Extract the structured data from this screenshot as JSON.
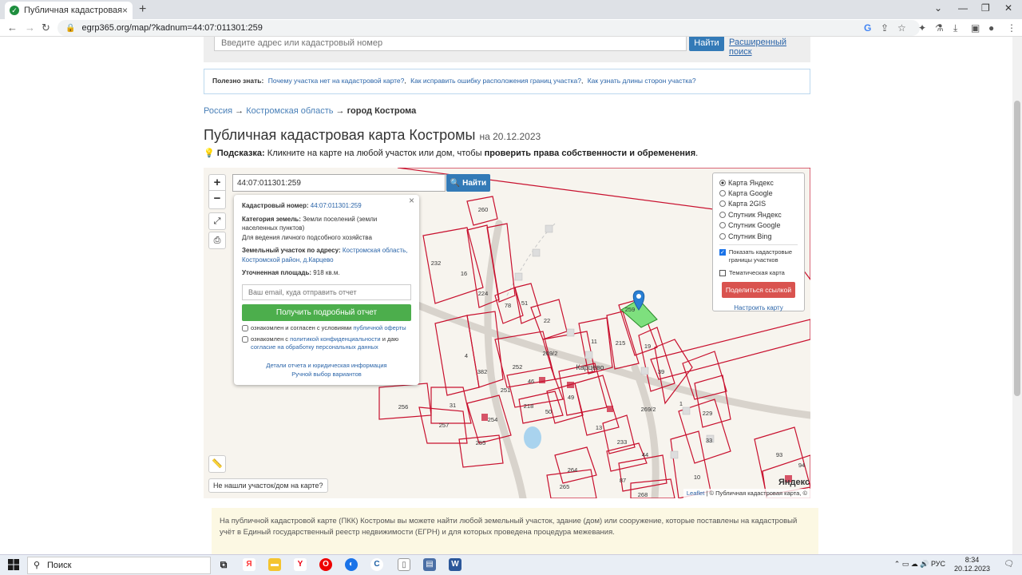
{
  "browser": {
    "tab_title": "Публичная кадастровая карта Ко",
    "tab_close": "×",
    "new_tab": "+",
    "url": "egrp365.org/map/?kadnum=44:07:011301:259"
  },
  "search": {
    "placeholder": "Введите адрес или кадастровый номер",
    "button": "Найти",
    "advanced": "Расширенный поиск"
  },
  "tips": {
    "label": "Полезно знать:",
    "links": [
      "Почему участка нет на кадастровой карте?",
      "Как исправить ошибку расположения границ участка?",
      "Как узнать длины сторон участка?"
    ]
  },
  "breadcrumb": {
    "items": [
      "Россия",
      "Костромская область"
    ],
    "separator": "→",
    "current": "город Кострома"
  },
  "heading": {
    "title": "Публичная кадастровая карта Костромы",
    "date": "на 20.12.2023"
  },
  "hint": {
    "label": "Подсказка:",
    "text": "Кликните на карте на любой участок или дом, чтобы",
    "bold": "проверить права собственности и обременения",
    "end": "."
  },
  "map": {
    "search_value": "44:07:011301:259",
    "search_button": "Найти",
    "zoom_in": "+",
    "zoom_out": "−",
    "village_label": "Карцево",
    "not_found": "Не нашли участок/дом на карте?",
    "attribution_leaflet": "Leaflet",
    "attribution_rest": "| © Публичная кадастровая карта, ©",
    "yandex_logo": "Яндекс",
    "layers": {
      "options": [
        "Карта Яндекс",
        "Карта Google",
        "Карта 2GIS",
        "Спутник Яндекс",
        "Спутник Google",
        "Спутник Bing"
      ],
      "selected": "Карта Яндекс",
      "show_borders": "Показать кадастровые границы участков",
      "thematic": "Тематическая карта",
      "share": "Поделиться ссылкой",
      "setup": "Настроить карту"
    },
    "parcel_labels": [
      {
        "t": "260"
      },
      {
        "t": "232"
      },
      {
        "t": "16"
      },
      {
        "t": "224"
      },
      {
        "t": "78"
      },
      {
        "t": "51"
      },
      {
        "t": "22"
      },
      {
        "t": "11"
      },
      {
        "t": "215"
      },
      {
        "t": "19"
      },
      {
        "t": "39"
      },
      {
        "t": "4"
      },
      {
        "t": "382"
      },
      {
        "t": "252"
      },
      {
        "t": "46"
      },
      {
        "t": "251"
      },
      {
        "t": "49"
      },
      {
        "t": "218"
      },
      {
        "t": "50"
      },
      {
        "t": "13"
      },
      {
        "t": "256"
      },
      {
        "t": "31"
      },
      {
        "t": "257"
      },
      {
        "t": "254"
      },
      {
        "t": "255"
      },
      {
        "t": "233"
      },
      {
        "t": "44"
      },
      {
        "t": "87"
      },
      {
        "t": "264"
      },
      {
        "t": "265"
      },
      {
        "t": "268"
      },
      {
        "t": "229"
      },
      {
        "t": "33"
      },
      {
        "t": "10"
      },
      {
        "t": "93"
      },
      {
        "t": "94"
      },
      {
        "t": "269/2"
      },
      {
        "t": "269/2"
      },
      {
        "t": "259"
      },
      {
        "t": "1"
      }
    ]
  },
  "popup": {
    "close": "×",
    "cadnum_label": "Кадастровый номер:",
    "cadnum": "44:07:011301:259",
    "category_label": "Категория земель:",
    "category": "Земли поселений (земли населенных пунктов)",
    "use": "Для ведения личного подсобного хозяйства",
    "address_label": "Земельный участок по адресу:",
    "address": "Костромская область, Костромской район, д.Карцево",
    "area_label": "Уточненная площадь:",
    "area": "918",
    "area_unit": "кв.м.",
    "email_placeholder": "Ваш email, куда отправить отчет",
    "report_button": "Получить подробный отчет",
    "agree1_text": "ознакомлен и согласен с условиями",
    "agree1_link": "публичной оферты",
    "agree2_text": "ознакомлен с",
    "agree2_link": "политикой конфиденциальности",
    "agree2_mid": "и даю",
    "agree2_link2": "согласие на обработку персональных данных",
    "details_link": "Детали отчета и юридическая информация",
    "manual_link": "Ручной выбор вариантов"
  },
  "info": {
    "text": "На публичной кадастровой карте (ПКК) Костромы вы можете найти любой земельный участок, здание (дом) или сооружение, которые поставлены на кадастровый учёт в Единый государственный реестр недвижимости (ЕГРН) и для которых проведена процедура межевания."
  },
  "taskbar": {
    "search": "Поиск",
    "lang": "РУС",
    "time": "8:34",
    "date": "20.12.2023"
  },
  "colors": {
    "parcel_stroke": "#c8102e",
    "selected_parcel": "#7ee07e",
    "find_button": "#337ab7",
    "report_button": "#4cae4c",
    "share_button": "#d9534f"
  }
}
